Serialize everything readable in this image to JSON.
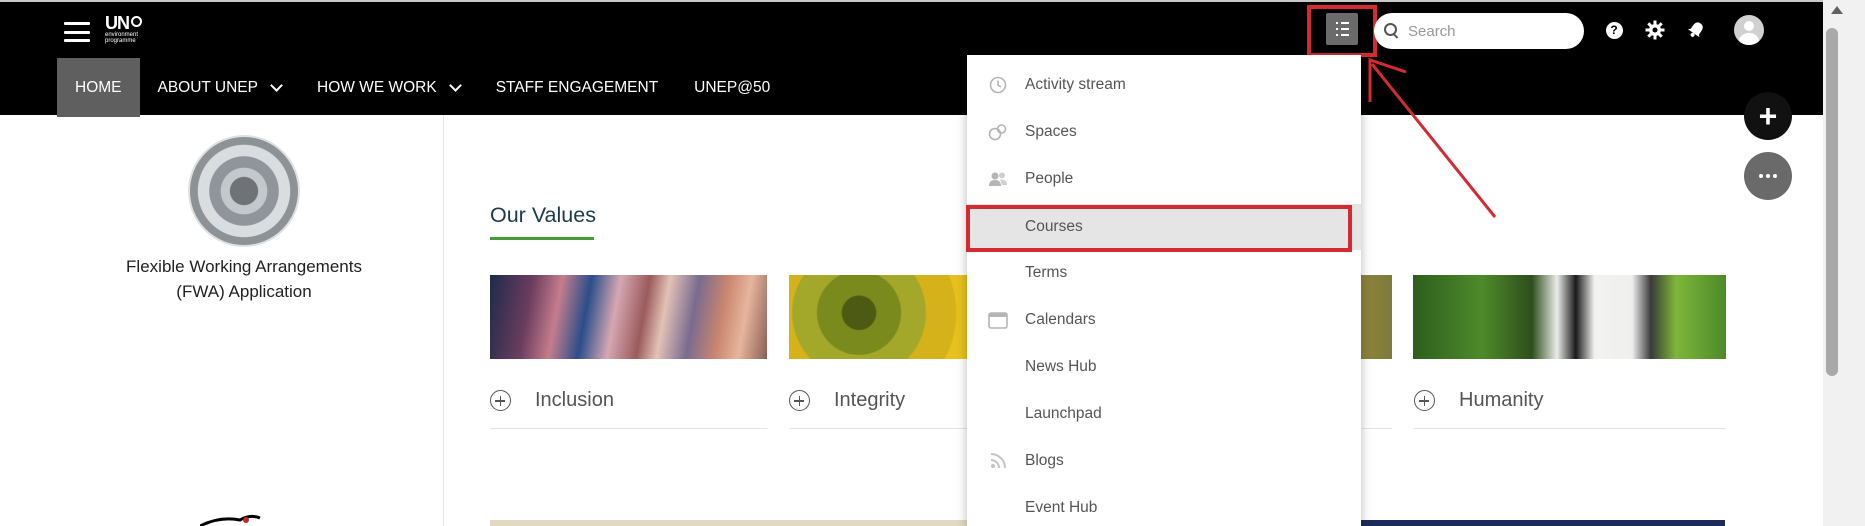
{
  "header": {
    "logo_text": "UN",
    "logo_subtext_1": "environment",
    "logo_subtext_2": "programme",
    "nav": [
      {
        "label": "HOME",
        "active": true,
        "has_dropdown": false
      },
      {
        "label": "ABOUT UNEP",
        "active": false,
        "has_dropdown": true
      },
      {
        "label": "HOW WE WORK",
        "active": false,
        "has_dropdown": true
      },
      {
        "label": "STAFF ENGAGEMENT",
        "active": false,
        "has_dropdown": false
      },
      {
        "label": "UNEP@50",
        "active": false,
        "has_dropdown": false
      }
    ],
    "search": {
      "placeholder": "Search",
      "value": ""
    },
    "help_glyph": "?"
  },
  "dropdown_menu": {
    "items": [
      {
        "label": "Activity stream",
        "icon": "clock-icon"
      },
      {
        "label": "Spaces",
        "icon": "spaces-icon"
      },
      {
        "label": "People",
        "icon": "people-icon"
      },
      {
        "label": "Courses",
        "icon": "",
        "highlighted": true
      },
      {
        "label": "Terms",
        "icon": ""
      },
      {
        "label": "Calendars",
        "icon": "calendar-icon"
      },
      {
        "label": "News Hub",
        "icon": ""
      },
      {
        "label": "Launchpad",
        "icon": ""
      },
      {
        "label": "Blogs",
        "icon": "rss-icon"
      },
      {
        "label": "Event Hub",
        "icon": ""
      }
    ]
  },
  "sidebar": {
    "fwa_title_line1": "Flexible Working Arrangements",
    "fwa_title_line2": "(FWA) Application"
  },
  "main": {
    "section_title": "Our Values",
    "cards": [
      {
        "label": "Inclusion",
        "image": "coral reef"
      },
      {
        "label": "Integrity",
        "image": "sunflower"
      },
      {
        "label": "Humanity",
        "image": "panda"
      }
    ]
  },
  "fab": {
    "plus_glyph": "+"
  },
  "annotation_color": "#d42a32"
}
